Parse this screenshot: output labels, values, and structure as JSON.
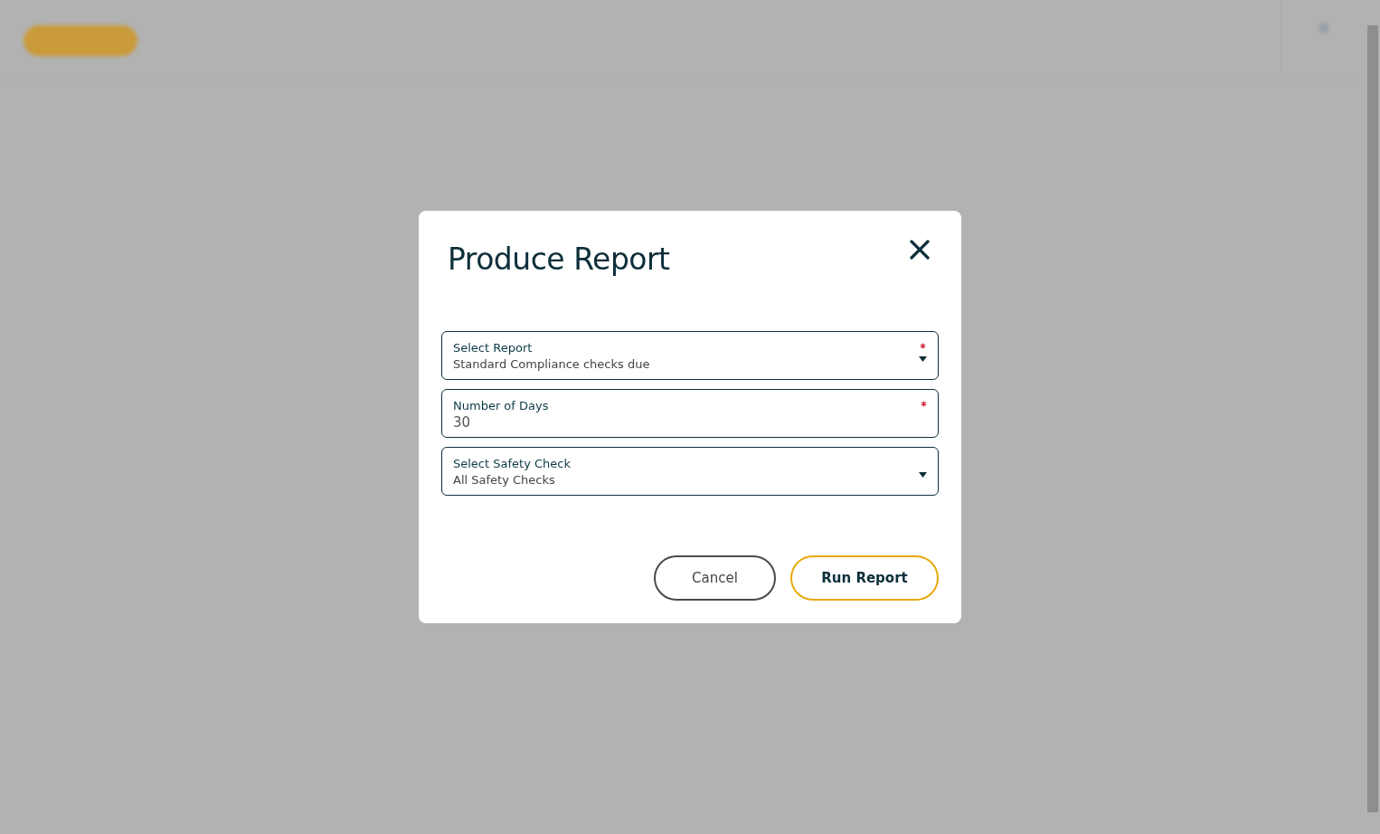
{
  "dialog": {
    "title": "Produce Report",
    "fields": [
      {
        "kind": "select",
        "label": "Select Report",
        "value": "Standard Compliance checks due",
        "required": true
      },
      {
        "kind": "input",
        "label": "Number of Days",
        "value": "30",
        "required": true
      },
      {
        "kind": "select",
        "label": "Select Safety Check",
        "value": "All Safety Checks",
        "required": false
      }
    ],
    "buttons": [
      {
        "kind": "secondary",
        "label": "Cancel"
      },
      {
        "kind": "primary",
        "label": "Run Report"
      }
    ]
  }
}
